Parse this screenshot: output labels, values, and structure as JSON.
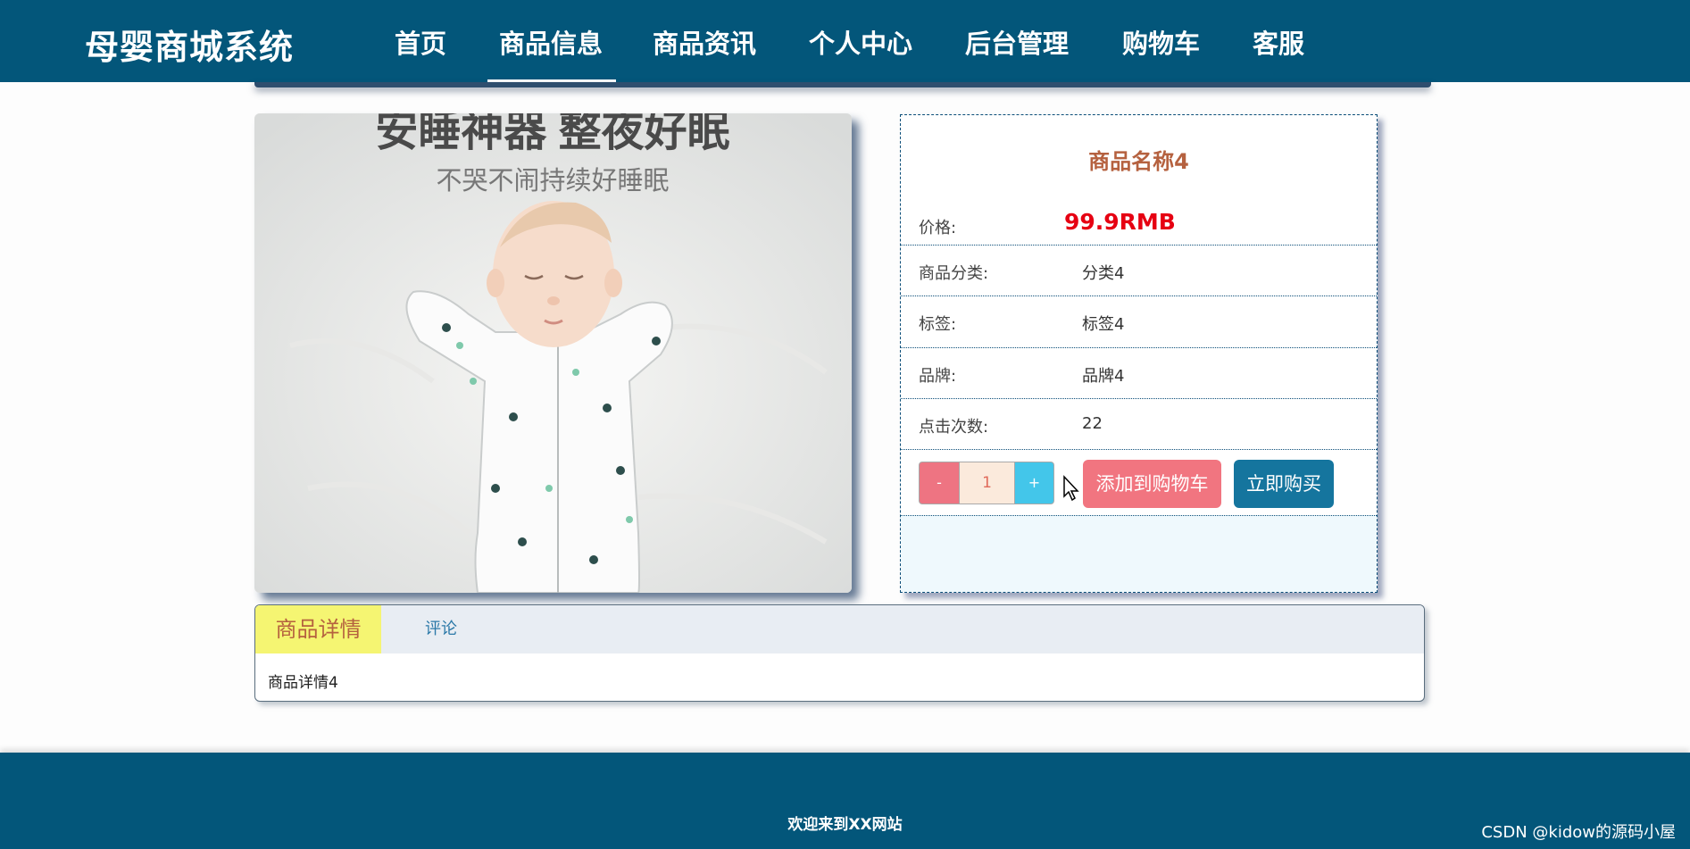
{
  "header": {
    "logo": "母婴商城系统",
    "nav": [
      "首页",
      "商品信息",
      "商品资讯",
      "个人中心",
      "后台管理",
      "购物车",
      "客服"
    ],
    "active_nav": "商品信息"
  },
  "product_image": {
    "headline": "安睡神器 整夜好眠",
    "subline": "不哭不闹持续好睡眠"
  },
  "product": {
    "name": "商品名称4",
    "price_label": "价格:",
    "price": "99.9RMB",
    "category_label": "商品分类:",
    "category": "分类4",
    "tag_label": "标签:",
    "tag": "标签4",
    "brand_label": "品牌:",
    "brand": "品牌4",
    "clicks_label": "点击次数:",
    "clicks": "22"
  },
  "cart": {
    "minus": "-",
    "quantity": "1",
    "plus": "+",
    "add_to_cart": "添加到购物车",
    "buy_now": "立即购买"
  },
  "tabs": {
    "details": "商品详情",
    "comments": "评论",
    "details_content": "商品详情4"
  },
  "footer": {
    "text": "欢迎来到XX网站"
  },
  "watermark": "CSDN @kidow的源码小屋",
  "colors": {
    "header_bg": "#03567a",
    "price": "#e60012",
    "title": "#b5613f",
    "add_cart": "#f17580",
    "buy_now": "#15759e",
    "tab_active": "#f5f572"
  }
}
